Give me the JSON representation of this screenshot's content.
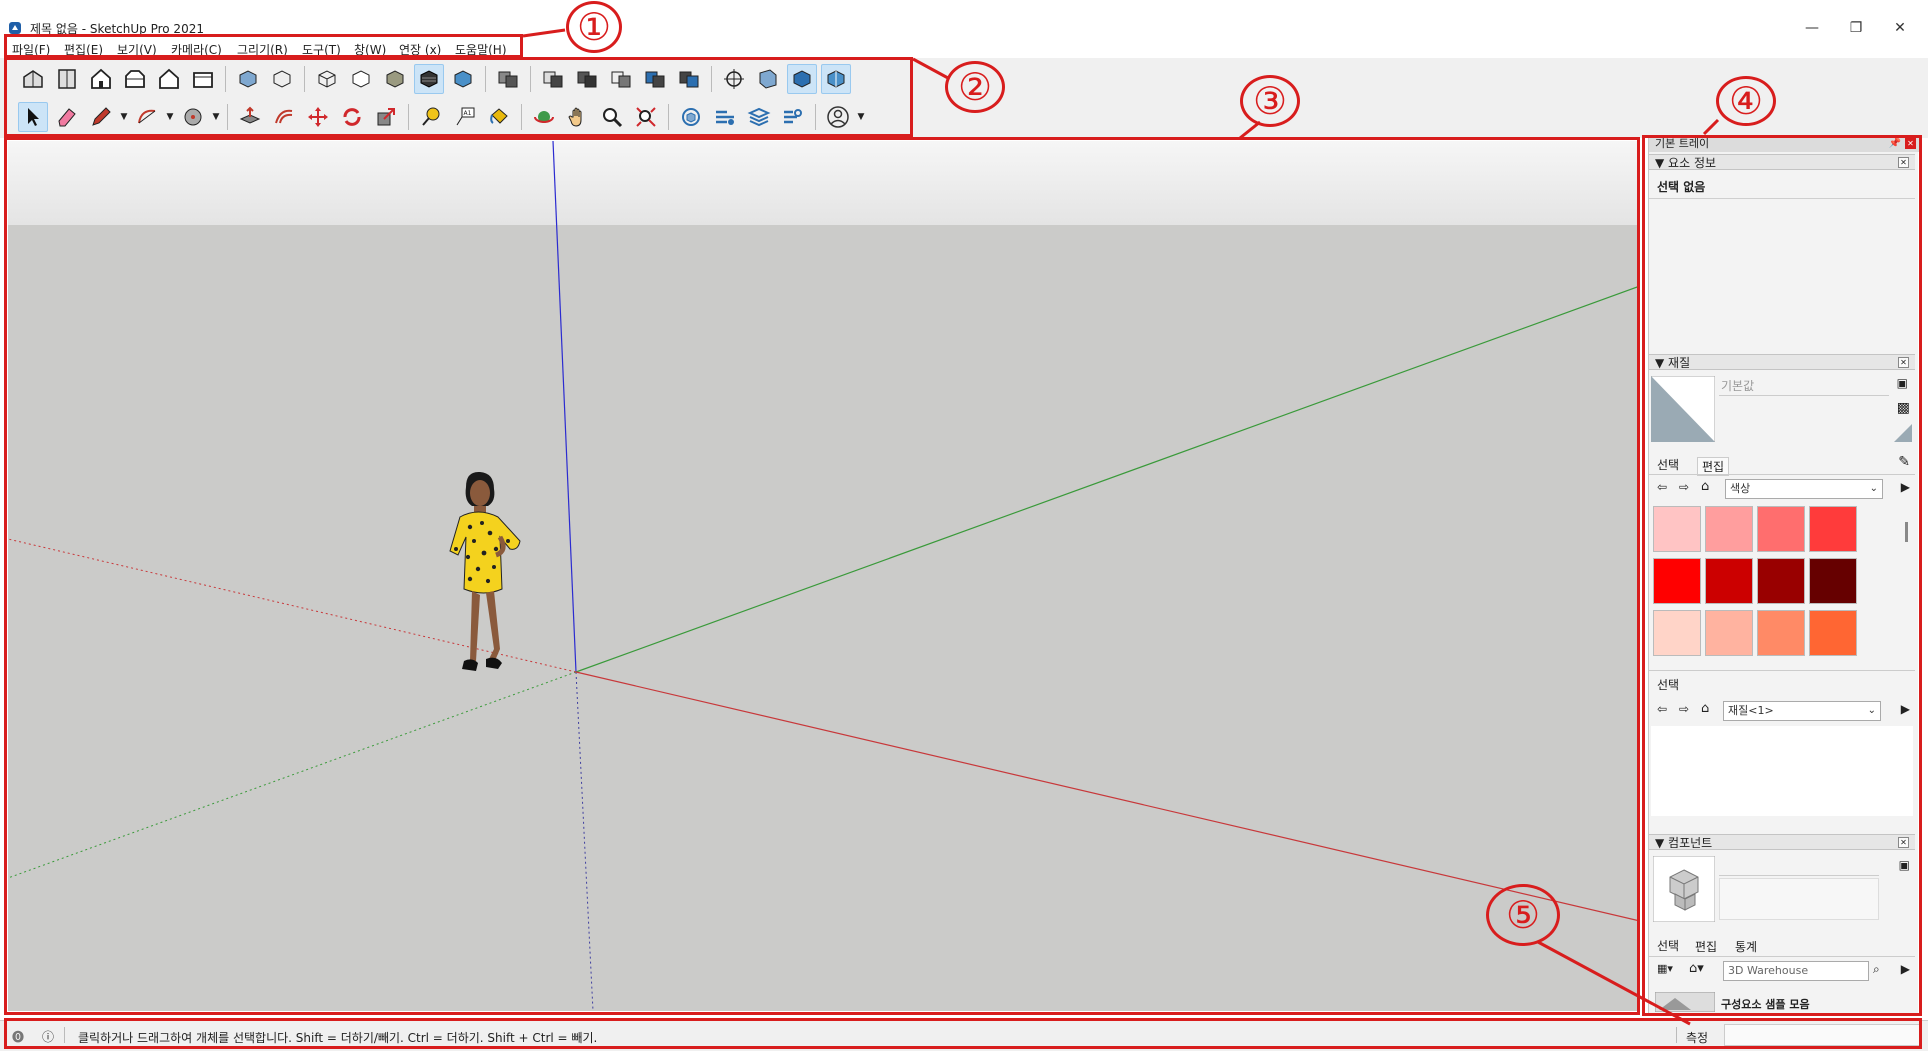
{
  "window": {
    "title": "제목 없음 - SketchUp Pro 2021",
    "minimize": "—",
    "restore": "❐",
    "close": "✕"
  },
  "menu": {
    "items": [
      {
        "label": "파일(F)"
      },
      {
        "label": "편집(E)"
      },
      {
        "label": "보기(V)"
      },
      {
        "label": "카메라(C)"
      },
      {
        "label": "그리기(R)"
      },
      {
        "label": "도구(T)"
      },
      {
        "label": "창(W)"
      },
      {
        "label": "연장 (x)"
      },
      {
        "label": "도움말(H)"
      }
    ]
  },
  "tray": {
    "title": "기본 트레이",
    "entity_info": {
      "header": "요소 정보",
      "status": "선택 없음"
    },
    "materials": {
      "header": "재질",
      "name_placeholder": "기본값",
      "tabs": [
        "선택",
        "편집"
      ],
      "collection": "색상",
      "swatches": [
        "#ffc4c4",
        "#ff9e9e",
        "#ff6e6e",
        "#ff3b3b",
        "#ff0000",
        "#cc0000",
        "#990000",
        "#660000",
        "#ffd4c8",
        "#ffb3a0",
        "#ff8a66",
        "#ff6633"
      ],
      "select_label": "선택",
      "model_collection": "재질<1>"
    },
    "components": {
      "header": "컴포넌트",
      "tabs": [
        "선택",
        "편집",
        "통계"
      ],
      "search_placeholder": "3D Warehouse",
      "sample_label": "구성요소 샘플 모음"
    }
  },
  "status": {
    "message": "클릭하거나 드래그하여 개체를 선택합니다. Shift = 더하기/빼기. Ctrl = 더하기. Shift + Ctrl = 빼기.",
    "measure_label": "측정"
  },
  "annotations": {
    "labels": [
      "①",
      "②",
      "③",
      "④",
      "⑤"
    ]
  },
  "colors": {
    "annotation": "#d81d1d",
    "x_axis": "#c8383a",
    "y_axis": "#3a9a3a",
    "z_axis": "#2b2bd0",
    "viewport_ground": "#cbcbc9"
  }
}
